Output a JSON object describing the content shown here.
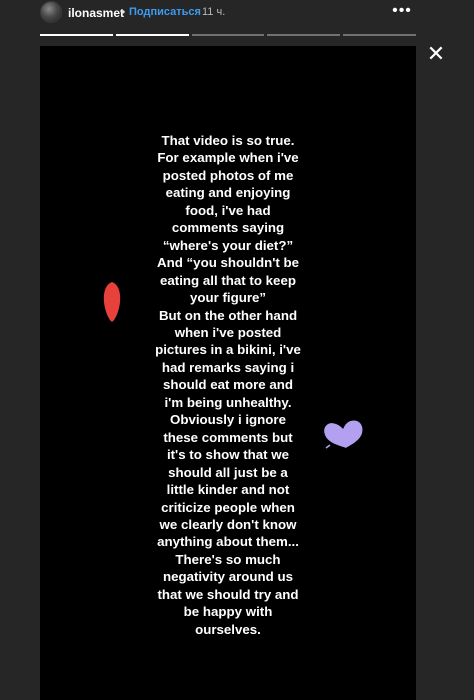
{
  "header": {
    "username": "ilonasmet",
    "separator": "•",
    "follow_label": "Подписаться",
    "time_ago": "11 ч.",
    "more_icon": "more-dots-icon",
    "more_glyph": "•••"
  },
  "progress": {
    "segments_total": 5,
    "segments_viewed": 2
  },
  "close": {
    "icon": "close-icon",
    "glyph": "✕"
  },
  "story": {
    "text_lines": [
      "That video is so true.",
      "For example when i've",
      "posted photos of me",
      "eating and enjoying",
      "food, i've had",
      "comments saying",
      "“where's your diet?”",
      "And “you shouldn't be",
      "eating all that to keep",
      "your figure”",
      "But on the other hand",
      "when i've posted",
      "pictures in a bikini, i've",
      "had remarks saying i",
      "should eat more and",
      "i'm being unhealthy.",
      "Obviously i ignore",
      "these comments but",
      "it's to show that we",
      "should all just be a",
      "little kinder and not",
      "criticize people when",
      "we clearly don't know",
      "anything about them...",
      "There's so much",
      "negativity around us",
      "that we should try and",
      "be happy with",
      "ourselves."
    ],
    "stickers": [
      {
        "name": "red-drop-sticker",
        "color": "#e8413c"
      },
      {
        "name": "purple-heart-sticker",
        "color": "#b4a0f0"
      }
    ]
  },
  "colors": {
    "background": "#262626",
    "story_background": "#000000",
    "follow_link": "#3d9bf0"
  }
}
